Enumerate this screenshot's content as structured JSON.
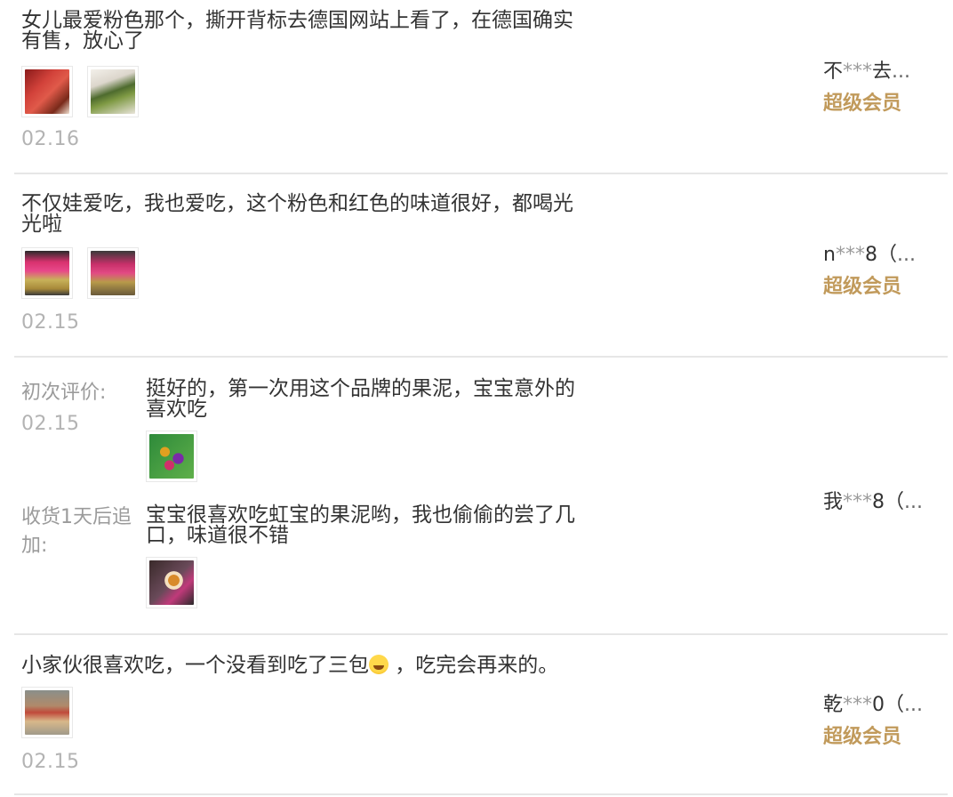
{
  "reviews": [
    {
      "text": "女儿最爱粉色那个，撕开背标去德国网站上看了，在德国确实\n有售，放心了",
      "date": "02.16",
      "user": {
        "prefix": "不",
        "mask": "***",
        "suffix": "去",
        "ellipsis": "..."
      },
      "badge": "超级会员",
      "photos": [
        "photo-red-pouch",
        "photo-green-pouch"
      ]
    },
    {
      "text": "不仅娃爱吃，我也爱吃，这个粉色和红色的味道很好，都喝光\n光啦",
      "date": "02.15",
      "user": {
        "prefix": "n",
        "mask": "***",
        "suffix": "8（",
        "ellipsis": "..."
      },
      "badge": "超级会员",
      "photos": [
        "photo-pink-pouches",
        "photo-pink-pouches-2"
      ]
    },
    {
      "initial_label": "初次评价:",
      "initial_date": "02.15",
      "initial_text": "挺好的，第一次用这个品牌的果泥，宝宝意外的\n喜欢吃",
      "followup_label": "收货1天后追\n加:",
      "followup_text": "宝宝很喜欢吃虹宝的果泥哟，我也偷偷的尝了几\n口，味道很不错",
      "user": {
        "prefix": "我",
        "mask": "***",
        "suffix": "8（",
        "ellipsis": "..."
      },
      "photos": [
        "photo-colorful-pouches",
        "photo-cup-pouch"
      ]
    },
    {
      "text_before_emoji": "小家伙很喜欢吃，一个没看到吃了三包",
      "emoji": "laughing-tears-emoji",
      "text_after_emoji": " ，吃完会再来的。",
      "date": "02.15",
      "user": {
        "prefix": "乾",
        "mask": "***",
        "suffix": "0（",
        "ellipsis": "..."
      },
      "badge": "超级会员",
      "photos": [
        "photo-box-pouch"
      ]
    }
  ]
}
